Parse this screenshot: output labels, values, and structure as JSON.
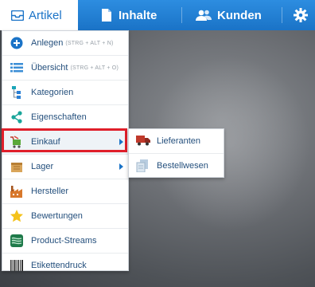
{
  "topbar": {
    "tabs": [
      {
        "label": "Artikel",
        "icon": "inbox-icon",
        "active": true
      },
      {
        "label": "Inhalte",
        "icon": "document-icon",
        "active": false
      },
      {
        "label": "Kunden",
        "icon": "users-icon",
        "active": false
      },
      {
        "label": "",
        "icon": "gear-icon",
        "active": false
      }
    ]
  },
  "menu": {
    "items": [
      {
        "label": "Anlegen",
        "shortcut": "(STRG + ALT + N)",
        "icon": "plus-circle-icon"
      },
      {
        "label": "Übersicht",
        "shortcut": "(STRG + ALT + O)",
        "icon": "list-icon"
      },
      {
        "label": "Kategorien",
        "shortcut": "",
        "icon": "tree-icon"
      },
      {
        "label": "Eigenschaften",
        "shortcut": "",
        "icon": "share-icon"
      },
      {
        "label": "Einkauf",
        "shortcut": "",
        "icon": "cart-icon"
      },
      {
        "label": "Lager",
        "shortcut": "",
        "icon": "box-icon"
      },
      {
        "label": "Hersteller",
        "shortcut": "",
        "icon": "factory-icon"
      },
      {
        "label": "Bewertungen",
        "shortcut": "",
        "icon": "star-icon"
      },
      {
        "label": "Product-Streams",
        "shortcut": "",
        "icon": "stream-icon"
      },
      {
        "label": "Etikettendruck",
        "shortcut": "",
        "icon": "barcode-icon"
      }
    ]
  },
  "submenu": {
    "items": [
      {
        "label": "Lieferanten",
        "icon": "truck-icon"
      },
      {
        "label": "Bestellwesen",
        "icon": "documents-icon"
      }
    ]
  },
  "colors": {
    "topbar": "#1a73c7",
    "highlight": "#e01f2a",
    "menu_text": "#25507d"
  }
}
